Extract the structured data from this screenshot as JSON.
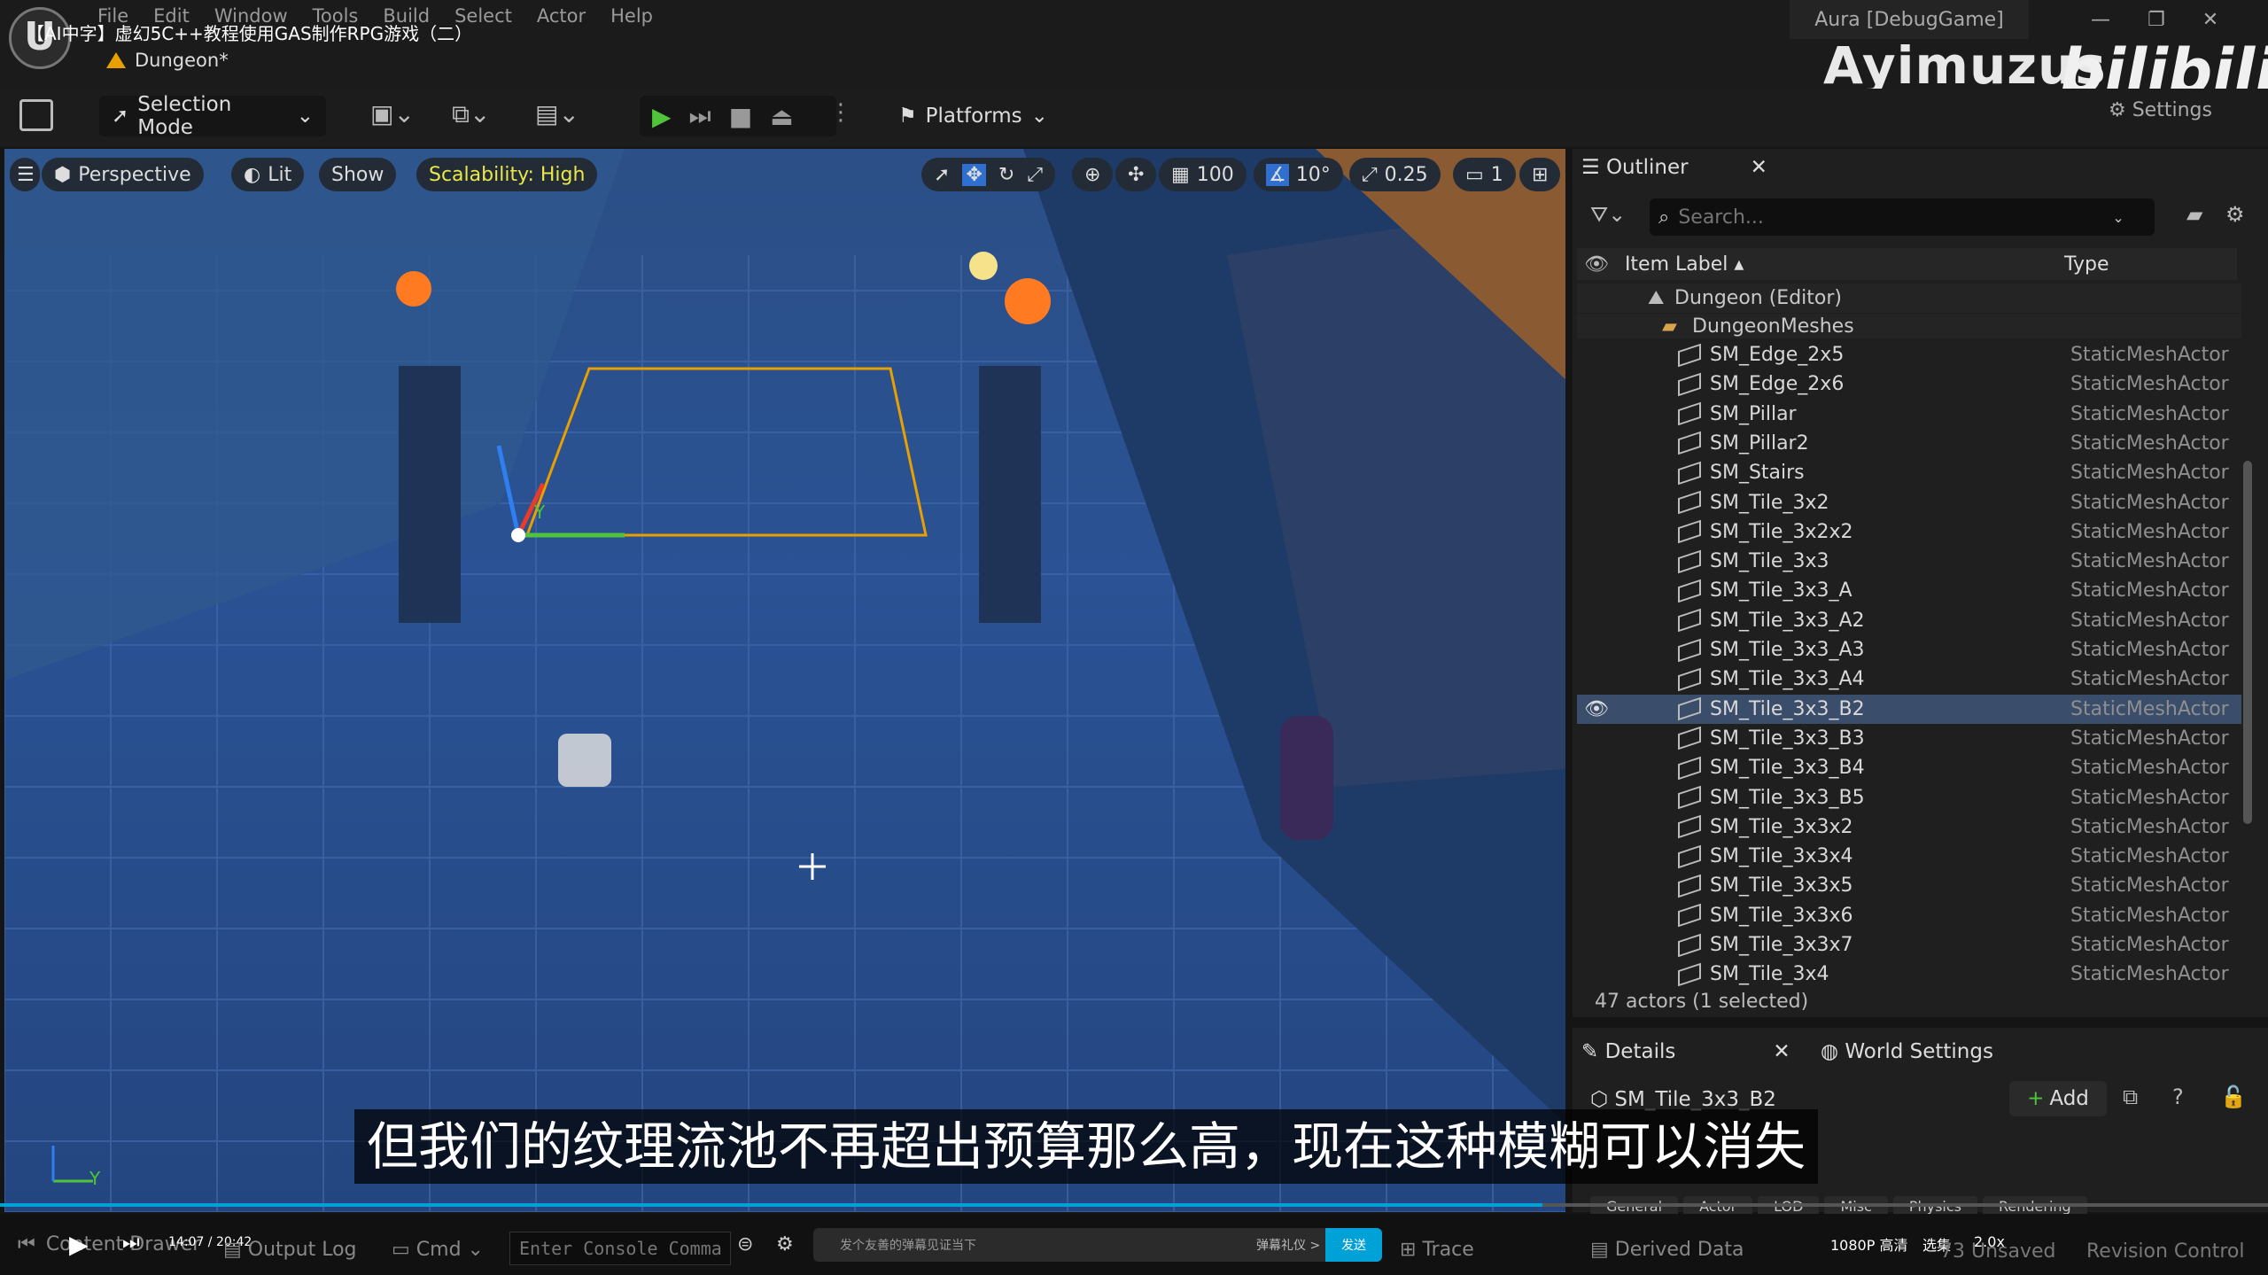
{
  "window": {
    "video_title": "【AI中字】虚幻5C++教程使用GAS制作RPG游戏（二）",
    "menu": [
      "File",
      "Edit",
      "Window",
      "Tools",
      "Build",
      "Select",
      "Actor",
      "Help"
    ],
    "tab": "Dungeon*",
    "project": "Aura [DebugGame]",
    "watermark": "Ayimuzus",
    "bili": "bilibili",
    "settings_label": "Settings"
  },
  "toolbar": {
    "mode": "Selection Mode",
    "platforms": "Platforms"
  },
  "viewport": {
    "perspective": "Perspective",
    "lit": "Lit",
    "show": "Show",
    "scalability": "Scalability: High",
    "grid_snap": "100",
    "angle_snap": "10°",
    "scale_snap": "0.25",
    "camera_speed": "1",
    "axis_y": "Y",
    "axis_gizmo_y": "Y"
  },
  "outliner": {
    "title": "Outliner",
    "search_placeholder": "Search...",
    "col_label": "Item Label ▴",
    "col_type": "Type",
    "root": "Dungeon (Editor)",
    "folder": "DungeonMeshes",
    "items": [
      {
        "name": "SM_Edge_2x5",
        "type": "StaticMeshActor"
      },
      {
        "name": "SM_Edge_2x6",
        "type": "StaticMeshActor"
      },
      {
        "name": "SM_Pillar",
        "type": "StaticMeshActor"
      },
      {
        "name": "SM_Pillar2",
        "type": "StaticMeshActor"
      },
      {
        "name": "SM_Stairs",
        "type": "StaticMeshActor"
      },
      {
        "name": "SM_Tile_3x2",
        "type": "StaticMeshActor"
      },
      {
        "name": "SM_Tile_3x2x2",
        "type": "StaticMeshActor"
      },
      {
        "name": "SM_Tile_3x3",
        "type": "StaticMeshActor"
      },
      {
        "name": "SM_Tile_3x3_A",
        "type": "StaticMeshActor"
      },
      {
        "name": "SM_Tile_3x3_A2",
        "type": "StaticMeshActor"
      },
      {
        "name": "SM_Tile_3x3_A3",
        "type": "StaticMeshActor"
      },
      {
        "name": "SM_Tile_3x3_A4",
        "type": "StaticMeshActor"
      },
      {
        "name": "SM_Tile_3x3_B2",
        "type": "StaticMeshActor",
        "selected": true
      },
      {
        "name": "SM_Tile_3x3_B3",
        "type": "StaticMeshActor"
      },
      {
        "name": "SM_Tile_3x3_B4",
        "type": "StaticMeshActor"
      },
      {
        "name": "SM_Tile_3x3_B5",
        "type": "StaticMeshActor"
      },
      {
        "name": "SM_Tile_3x3x2",
        "type": "StaticMeshActor"
      },
      {
        "name": "SM_Tile_3x3x4",
        "type": "StaticMeshActor"
      },
      {
        "name": "SM_Tile_3x3x5",
        "type": "StaticMeshActor"
      },
      {
        "name": "SM_Tile_3x3x6",
        "type": "StaticMeshActor"
      },
      {
        "name": "SM_Tile_3x3x7",
        "type": "StaticMeshActor"
      },
      {
        "name": "SM_Tile_3x4",
        "type": "StaticMeshActor"
      }
    ],
    "status": "47 actors (1 selected)"
  },
  "details": {
    "title": "Details",
    "world_settings": "World Settings",
    "actor": "SM_Tile_3x3_B2",
    "add": "Add",
    "tabs": [
      "General",
      "Actor",
      "LOD",
      "Misc",
      "Physics",
      "Rendering"
    ]
  },
  "bottom": {
    "content_drawer": "Content Drawer",
    "output_log": "Output Log",
    "cmd": "Cmd",
    "console_placeholder": "Enter Console Command",
    "time": "14:07 / 20:42",
    "danmaku": "发个友善的弹幕见证当下",
    "danmaku_etiquette": "弹幕礼仪 >",
    "send": "发送",
    "trace": "Trace",
    "derived_data": "Derived Data",
    "quality": "1080P 高清",
    "episodes": "选集",
    "speed": "2.0x",
    "unsaved": "73 Unsaved",
    "revision": "Revision Control"
  },
  "subtitle": "但我们的纹理流池不再超出预算那么高，现在这种模糊可以消失",
  "colors": {
    "accent_selected": "#3a4d6b",
    "play_green": "#4fc43b",
    "scalability_yellow": "#e8e84a",
    "send_blue": "#00a1d6"
  }
}
